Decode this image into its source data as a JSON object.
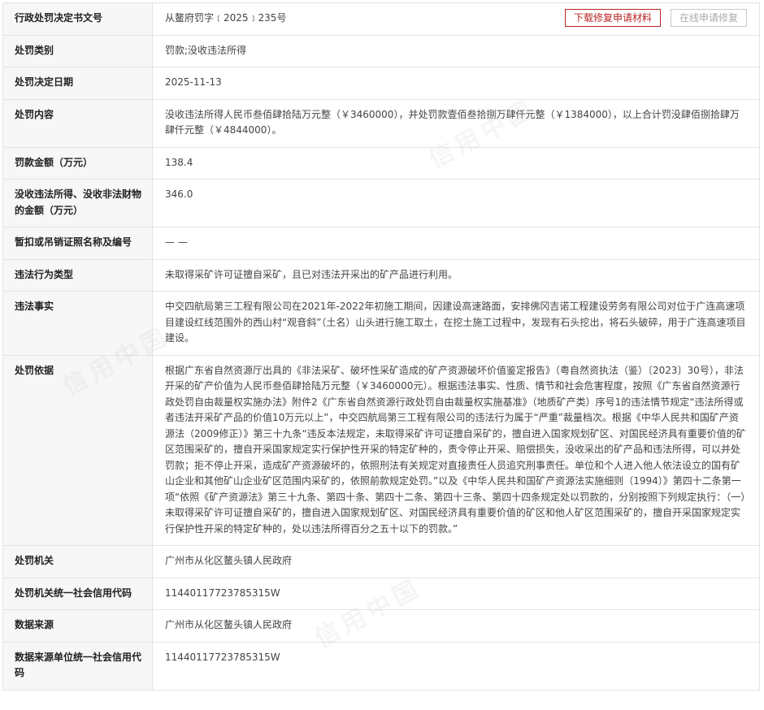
{
  "colors": {
    "label_bg": "#f7f7f7",
    "border": "#e4e4e4",
    "accent_red": "#b82525",
    "disabled_gray": "#aaaaaa"
  },
  "actions": {
    "download_label": "下载修复申请材料",
    "online_label": "在线申请修复"
  },
  "watermark": "信用中国",
  "rows": [
    {
      "label": "行政处罚决定书文号",
      "value": "从鳌府罚字﹝2025﹞235号"
    },
    {
      "label": "处罚类别",
      "value": "罚款;没收违法所得"
    },
    {
      "label": "处罚决定日期",
      "value": "2025-11-13"
    },
    {
      "label": "处罚内容",
      "value": "没收违法所得人民币叁佰肆拾陆万元整（￥3460000），并处罚款壹佰叁拾捌万肆仟元整（￥1384000），以上合计罚没肆佰捌拾肆万肆仟元整（￥4844000）。"
    },
    {
      "label": "罚款金额（万元）",
      "value": "138.4"
    },
    {
      "label": "没收违法所得、没收非法财物的金额（万元）",
      "value": "346.0"
    },
    {
      "label": "暂扣或吊销证照名称及编号",
      "value": "— —"
    },
    {
      "label": "违法行为类型",
      "value": "未取得采矿许可证擅自采矿，且已对违法开采出的矿产品进行利用。"
    },
    {
      "label": "违法事实",
      "value": "中交四航局第三工程有限公司在2021年-2022年初施工期间，因建设高速路面，安排佛冈吉诺工程建设劳务有限公司对位于广连高速项目建设红线范围外的西山村“观音斜”（土名）山头进行施工取土，在挖土施工过程中，发现有石头挖出，将石头破碎，用于广连高速项目建设。"
    },
    {
      "label": "处罚依据",
      "value": "根据广东省自然资源厅出具的《非法采矿、破坏性采矿造成的矿产资源破坏价值鉴定报告》（粤自然资执法（鉴）〔2023〕30号），非法开采的矿产价值为人民币叁佰肆拾陆万元整（￥3460000元）。根据违法事实、性质、情节和社会危害程度，按照《广东省自然资源行政处罚自由裁量权实施办法》附件2《广东省自然资源行政处罚自由裁量权实施基准》（地质矿产类）序号1的违法情节规定“违法所得或者违法开采矿产品的价值10万元以上”，中交四航局第三工程有限公司的违法行为属于“严重”裁量档次。根据《中华人民共和国矿产资源法（2009修正）》第三十九条“违反本法规定，未取得采矿许可证擅自采矿的，擅自进入国家规划矿区、对国民经济具有重要价值的矿区范围采矿的，擅自开采国家规定实行保护性开采的特定矿种的，责令停止开采、赔偿损失，没收采出的矿产品和违法所得，可以并处罚款；拒不停止开采，造成矿产资源破坏的，依照刑法有关规定对直接责任人员追究刑事责任。单位和个人进入他人依法设立的国有矿山企业和其他矿山企业矿区范围内采矿的，依照前款规定处罚。”以及《中华人民共和国矿产资源法实施细则（1994）》第四十二条第一项“依照《矿产资源法》第三十九条、第四十条、第四十二条、第四十三条、第四十四条规定处以罚款的，分别按照下列规定执行：（一）未取得采矿许可证擅自采矿的，擅自进入国家规划矿区、对国民经济具有重要价值的矿区和他人矿区范围采矿的，擅自开采国家规定实行保护性开采的特定矿种的，处以违法所得百分之五十以下的罚款。”"
    },
    {
      "label": "处罚机关",
      "value": "广州市从化区鳌头镇人民政府"
    },
    {
      "label": "处罚机关统一社会信用代码",
      "value": "11440117723785315W"
    },
    {
      "label": "数据来源",
      "value": "广州市从化区鳌头镇人民政府"
    },
    {
      "label": "数据来源单位统一社会信用代码",
      "value": "11440117723785315W"
    }
  ]
}
